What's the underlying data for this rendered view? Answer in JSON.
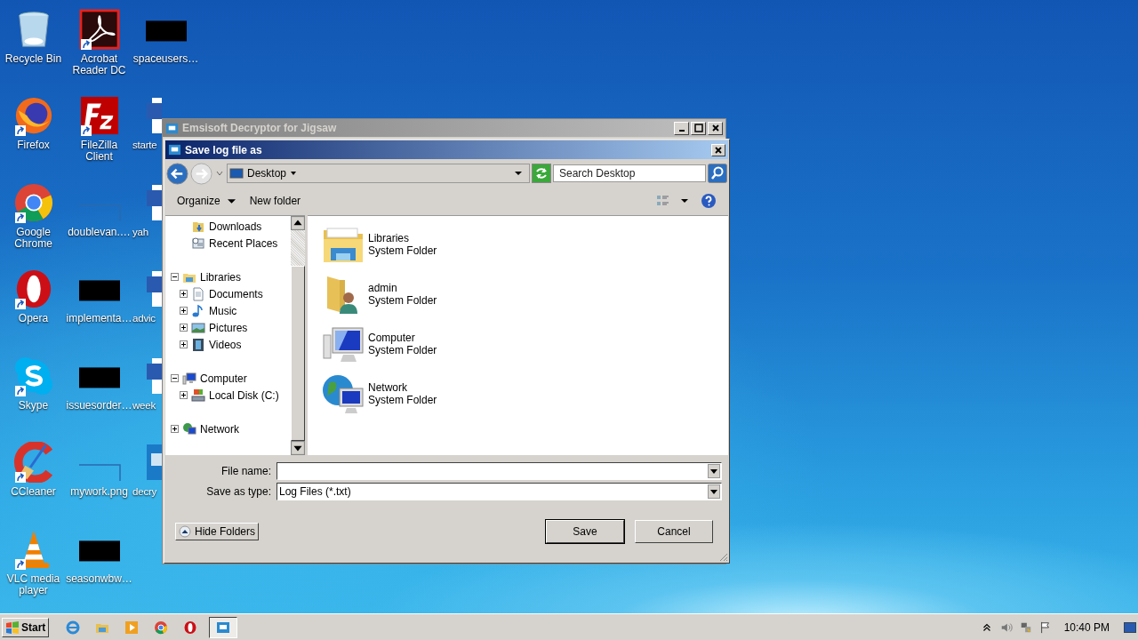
{
  "desktop": {
    "columns": [
      [
        {
          "label": "Recycle Bin",
          "shortcut": false
        },
        {
          "label": "Firefox",
          "shortcut": true
        },
        {
          "label": "Google Chrome",
          "shortcut": true
        },
        {
          "label": "Opera",
          "shortcut": true
        },
        {
          "label": "Skype",
          "shortcut": true
        },
        {
          "label": "CCleaner",
          "shortcut": true
        },
        {
          "label": "VLC media player",
          "shortcut": true
        }
      ],
      [
        {
          "label": "Acrobat Reader DC",
          "shortcut": true
        },
        {
          "label": "FileZilla Client",
          "shortcut": true
        },
        {
          "label": "doublevan.…",
          "shortcut": false
        },
        {
          "label": "implementa…",
          "shortcut": false
        },
        {
          "label": "issuesorder…",
          "shortcut": false
        },
        {
          "label": "mywork.png",
          "shortcut": false
        },
        {
          "label": "seasonwbw…",
          "shortcut": false
        }
      ],
      [
        {
          "label": "spaceusers…",
          "shortcut": false
        },
        {
          "label": "starte",
          "shortcut": false
        },
        {
          "label": "yah",
          "shortcut": false
        },
        {
          "label": "advic",
          "shortcut": false
        },
        {
          "label": "week",
          "shortcut": false
        },
        {
          "label": "decry",
          "shortcut": false
        }
      ]
    ]
  },
  "parent_window": {
    "title": "Emsisoft Decryptor for Jigsaw",
    "active": false
  },
  "dialog": {
    "title": "Save log file as",
    "back": {
      "disabled": false
    },
    "forward": {
      "disabled": true
    },
    "address": "Desktop",
    "search": {
      "placeholder": "Search Desktop"
    },
    "toolbar": [
      {
        "label": "Organize",
        "menu": true
      },
      {
        "label": "New folder",
        "menu": false
      }
    ],
    "tree": [
      {
        "children": [
          {
            "label": "Downloads"
          },
          {
            "label": "Recent Places"
          }
        ]
      },
      {
        "label": "Libraries",
        "expanded": true,
        "children": [
          {
            "label": "Documents",
            "expanded": false
          },
          {
            "label": "Music",
            "expanded": false
          },
          {
            "label": "Pictures",
            "expanded": false
          },
          {
            "label": "Videos",
            "expanded": false
          }
        ]
      },
      {
        "label": "Computer",
        "expanded": true,
        "children": [
          {
            "label": "Local Disk (C:)",
            "expanded": false
          }
        ]
      },
      {
        "label": "Network",
        "expanded": false
      }
    ],
    "files": [
      {
        "name": "Libraries",
        "type": "System Folder"
      },
      {
        "name": "admin",
        "type": "System Folder"
      },
      {
        "name": "Computer",
        "type": "System Folder"
      },
      {
        "name": "Network",
        "type": "System Folder"
      }
    ],
    "file_name": {
      "label": "File name:"
    },
    "save_as_type": {
      "label": "Save as type:",
      "value": "Log Files (*.txt)"
    },
    "hide_folders": "Hide Folders",
    "save": "Save",
    "cancel": "Cancel"
  },
  "taskbar": {
    "start": "Start",
    "items": [
      {
        "selected": false
      },
      {
        "selected": false
      },
      {
        "selected": false
      },
      {
        "selected": false
      },
      {
        "selected": false
      },
      {
        "selected": true
      }
    ],
    "clock": "10:40 PM"
  }
}
